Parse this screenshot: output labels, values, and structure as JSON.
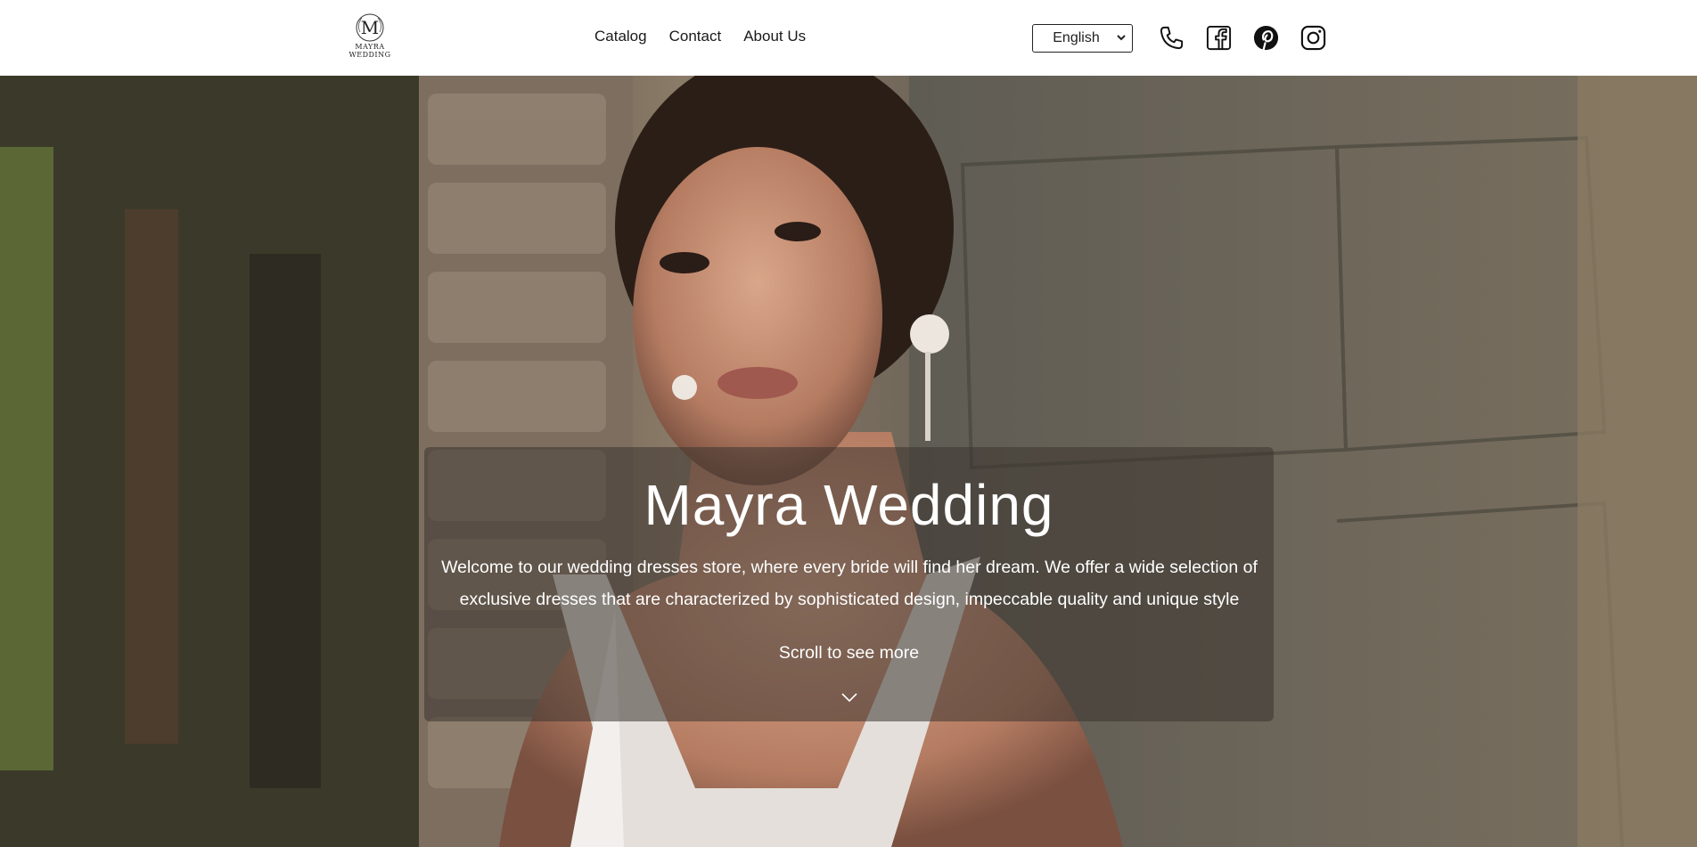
{
  "brand": {
    "logo_letter": "M",
    "logo_line1": "MAYRA",
    "logo_line2": "WEDDING"
  },
  "nav": {
    "items": [
      {
        "label": "Catalog"
      },
      {
        "label": "Contact"
      },
      {
        "label": "About Us"
      }
    ]
  },
  "language": {
    "selected": "English"
  },
  "social": {
    "icons": [
      "phone-icon",
      "facebook-icon",
      "pinterest-icon",
      "instagram-icon"
    ]
  },
  "hero": {
    "title": "Mayra Wedding",
    "description": "Welcome to our wedding dresses store, where every bride will find her dream. We offer a wide selection of exclusive dresses that are characterized by sophisticated design, impeccable quality and unique style",
    "scroll_label": "Scroll to see more"
  },
  "colors": {
    "header_bg": "#ffffff",
    "text_dark": "#1a1a1a",
    "overlay": "rgba(60,52,48,0.55)",
    "hero_text": "#ffffff"
  }
}
